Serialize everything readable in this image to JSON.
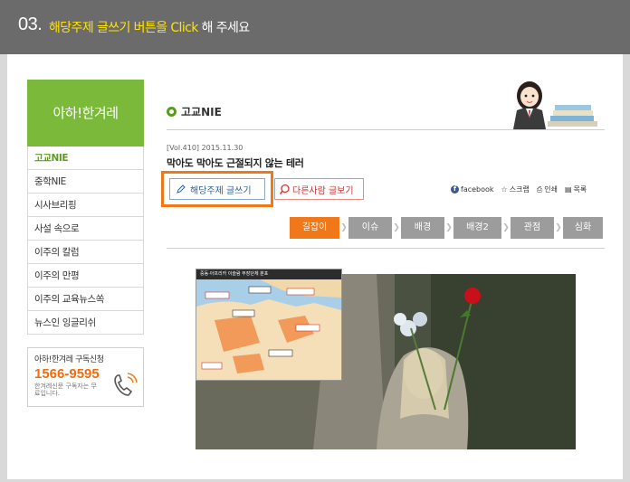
{
  "step": {
    "number": "03.",
    "highlight": "해당주제 글쓰기 버튼을 Click",
    "suffix": " 해 주세요"
  },
  "sidebar": {
    "brand": "아하!한겨레",
    "items": [
      {
        "label": "고교NIE",
        "active": true
      },
      {
        "label": "중학NIE",
        "active": false
      },
      {
        "label": "시사브리핑",
        "active": false
      },
      {
        "label": "사설 속으로",
        "active": false
      },
      {
        "label": "이주의 칼럼",
        "active": false
      },
      {
        "label": "이주의 만평",
        "active": false
      },
      {
        "label": "이주의 교육뉴스쏙",
        "active": false
      },
      {
        "label": "뉴스인 잉글리쉬",
        "active": false
      }
    ],
    "subscribe": {
      "title": "아하!한겨레 구독신청",
      "phone": "1566-9595",
      "note": "한겨레신문 구독자는 무료입니다."
    }
  },
  "section": {
    "title": "고교NIE"
  },
  "article": {
    "meta": "[Vol.410]  2015.11.30",
    "title": "막아도 막아도 근절되지 않는 테러"
  },
  "buttons": {
    "write": "해당주제 글쓰기",
    "view": "다른사람 글보기"
  },
  "tools": {
    "facebook": "facebook",
    "scrap": "스크랩",
    "print": "인쇄",
    "list": "목록"
  },
  "tabs": [
    {
      "label": "길잡이",
      "active": true
    },
    {
      "label": "이슈",
      "active": false
    },
    {
      "label": "배경",
      "active": false
    },
    {
      "label": "배경2",
      "active": false
    },
    {
      "label": "관점",
      "active": false
    },
    {
      "label": "심화",
      "active": false
    }
  ],
  "colors": {
    "accent": "#f07818",
    "brand_green": "#7ab93a",
    "step_yellow": "#ffe400",
    "topbar": "#6b6b6b"
  },
  "icons": {
    "write": "pencil-icon",
    "view": "magnifier-icon",
    "scrap": "star-icon",
    "print": "printer-icon",
    "list": "list-icon",
    "phone": "phone-icon"
  },
  "inset_map": {
    "title": "중동·아프리카 이슬람 무장단체 분포"
  }
}
